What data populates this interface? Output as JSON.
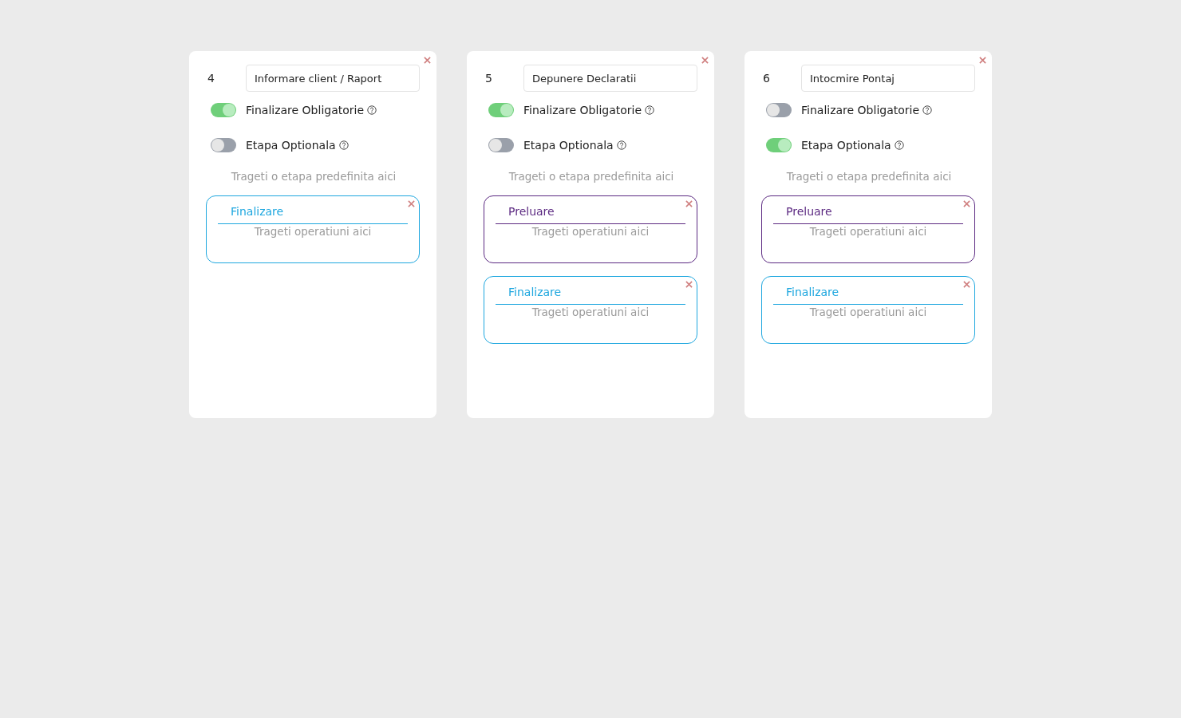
{
  "stages": [
    {
      "number": "4",
      "name": "Informare client / Raport",
      "mandatory": {
        "label": "Finalizare Obligatorie",
        "on": true
      },
      "optional": {
        "label": "Etapa Optionala",
        "on": false
      },
      "drop_hint": "Trageti o etapa predefinita aici",
      "operations": [
        {
          "title": "Finalizare",
          "color": "#1ea7df",
          "placeholder": "Trageti operatiuni aici"
        }
      ]
    },
    {
      "number": "5",
      "name": "Depunere Declaratii",
      "mandatory": {
        "label": "Finalizare Obligatorie",
        "on": true
      },
      "optional": {
        "label": "Etapa Optionala",
        "on": false
      },
      "drop_hint": "Trageti o etapa predefinita aici",
      "operations": [
        {
          "title": "Preluare",
          "color": "#5c2a82",
          "placeholder": "Trageti operatiuni aici"
        },
        {
          "title": "Finalizare",
          "color": "#1ea7df",
          "placeholder": "Trageti operatiuni aici"
        }
      ]
    },
    {
      "number": "6",
      "name": "Intocmire Pontaj",
      "mandatory": {
        "label": "Finalizare Obligatorie",
        "on": false
      },
      "optional": {
        "label": "Etapa Optionala",
        "on": true
      },
      "drop_hint": "Trageti o etapa predefinita aici",
      "operations": [
        {
          "title": "Preluare",
          "color": "#5c2a82",
          "placeholder": "Trageti operatiuni aici"
        },
        {
          "title": "Finalizare",
          "color": "#1ea7df",
          "placeholder": "Trageti operatiuni aici"
        }
      ]
    }
  ]
}
